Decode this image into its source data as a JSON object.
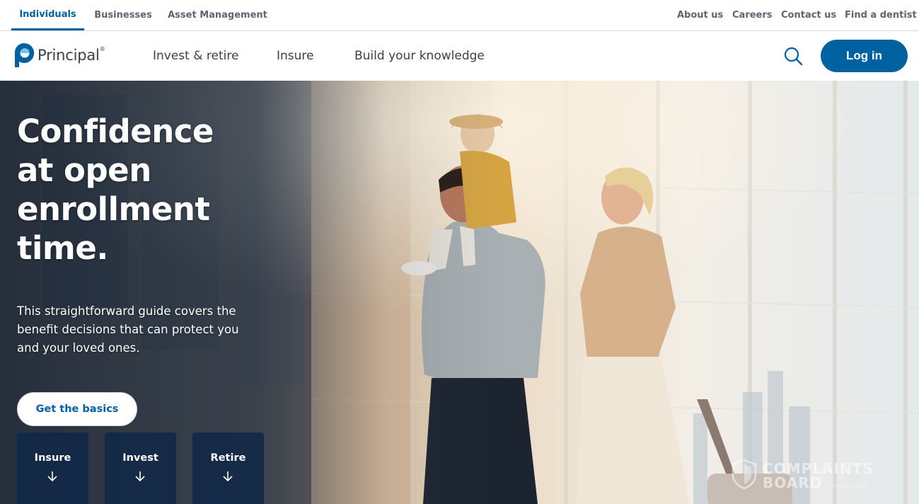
{
  "segments": [
    {
      "label": "Individuals",
      "active": true
    },
    {
      "label": "Businesses",
      "active": false
    },
    {
      "label": "Asset Management",
      "active": false
    }
  ],
  "utility_links": [
    "About us",
    "Careers",
    "Contact us",
    "Find a dentist"
  ],
  "brand": {
    "name": "Principal",
    "registered": "®",
    "color": "#0061a0"
  },
  "nav": {
    "items": [
      "Invest & retire",
      "Insure",
      "Build your knowledge"
    ],
    "search_icon": "search-icon",
    "login_label": "Log in"
  },
  "hero": {
    "headline": [
      "Confidence",
      "at open",
      "enrollment",
      "time."
    ],
    "description": "This straightforward guide covers the benefit decisions that can protect you and your loved ones.",
    "cta_label": "Get the basics",
    "tiles": [
      {
        "label": "Insure",
        "icon": "arrow-down-icon"
      },
      {
        "label": "Invest",
        "icon": "arrow-down-icon"
      },
      {
        "label": "Retire",
        "icon": "arrow-down-icon"
      }
    ]
  },
  "watermark": {
    "line1": "COMPLAINTS",
    "line2": "BOARD",
    "line3": "SINCE 2004"
  },
  "colors": {
    "accent": "#0061a0",
    "tile": "#102848",
    "text": "#3b4148"
  }
}
